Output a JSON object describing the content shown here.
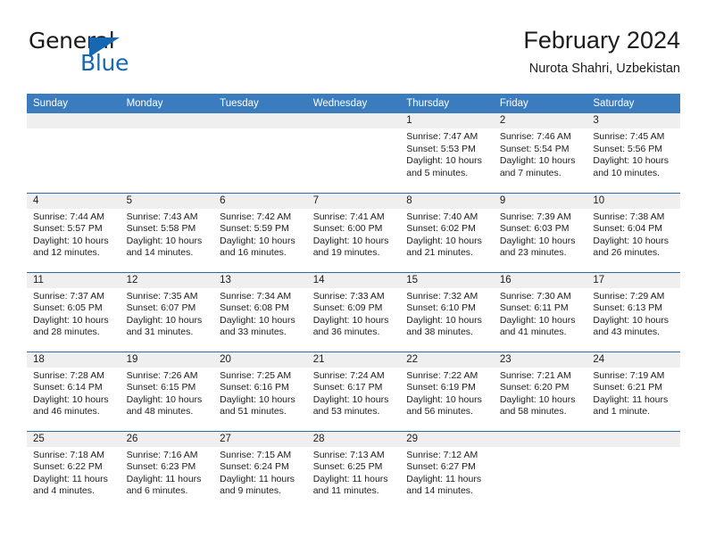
{
  "brand": {
    "name_part1": "General",
    "name_part2": "Blue",
    "triangle_icon": "triangle-icon",
    "accent_color": "#1668b3"
  },
  "header": {
    "title": "February 2024",
    "subtitle": "Nurota Shahri, Uzbekistan"
  },
  "theme": {
    "header_blue": "#3a7cbe",
    "row_rule_blue": "#2b6cad",
    "daynum_band": "#efefef",
    "text": "#1c1c1c"
  },
  "weekdays": [
    "Sunday",
    "Monday",
    "Tuesday",
    "Wednesday",
    "Thursday",
    "Friday",
    "Saturday"
  ],
  "weeks": [
    [
      {
        "day": ""
      },
      {
        "day": ""
      },
      {
        "day": ""
      },
      {
        "day": ""
      },
      {
        "day": "1",
        "sunrise": "Sunrise: 7:47 AM",
        "sunset": "Sunset: 5:53 PM",
        "daylight": "Daylight: 10 hours and 5 minutes."
      },
      {
        "day": "2",
        "sunrise": "Sunrise: 7:46 AM",
        "sunset": "Sunset: 5:54 PM",
        "daylight": "Daylight: 10 hours and 7 minutes."
      },
      {
        "day": "3",
        "sunrise": "Sunrise: 7:45 AM",
        "sunset": "Sunset: 5:56 PM",
        "daylight": "Daylight: 10 hours and 10 minutes."
      }
    ],
    [
      {
        "day": "4",
        "sunrise": "Sunrise: 7:44 AM",
        "sunset": "Sunset: 5:57 PM",
        "daylight": "Daylight: 10 hours and 12 minutes."
      },
      {
        "day": "5",
        "sunrise": "Sunrise: 7:43 AM",
        "sunset": "Sunset: 5:58 PM",
        "daylight": "Daylight: 10 hours and 14 minutes."
      },
      {
        "day": "6",
        "sunrise": "Sunrise: 7:42 AM",
        "sunset": "Sunset: 5:59 PM",
        "daylight": "Daylight: 10 hours and 16 minutes."
      },
      {
        "day": "7",
        "sunrise": "Sunrise: 7:41 AM",
        "sunset": "Sunset: 6:00 PM",
        "daylight": "Daylight: 10 hours and 19 minutes."
      },
      {
        "day": "8",
        "sunrise": "Sunrise: 7:40 AM",
        "sunset": "Sunset: 6:02 PM",
        "daylight": "Daylight: 10 hours and 21 minutes."
      },
      {
        "day": "9",
        "sunrise": "Sunrise: 7:39 AM",
        "sunset": "Sunset: 6:03 PM",
        "daylight": "Daylight: 10 hours and 23 minutes."
      },
      {
        "day": "10",
        "sunrise": "Sunrise: 7:38 AM",
        "sunset": "Sunset: 6:04 PM",
        "daylight": "Daylight: 10 hours and 26 minutes."
      }
    ],
    [
      {
        "day": "11",
        "sunrise": "Sunrise: 7:37 AM",
        "sunset": "Sunset: 6:05 PM",
        "daylight": "Daylight: 10 hours and 28 minutes."
      },
      {
        "day": "12",
        "sunrise": "Sunrise: 7:35 AM",
        "sunset": "Sunset: 6:07 PM",
        "daylight": "Daylight: 10 hours and 31 minutes."
      },
      {
        "day": "13",
        "sunrise": "Sunrise: 7:34 AM",
        "sunset": "Sunset: 6:08 PM",
        "daylight": "Daylight: 10 hours and 33 minutes."
      },
      {
        "day": "14",
        "sunrise": "Sunrise: 7:33 AM",
        "sunset": "Sunset: 6:09 PM",
        "daylight": "Daylight: 10 hours and 36 minutes."
      },
      {
        "day": "15",
        "sunrise": "Sunrise: 7:32 AM",
        "sunset": "Sunset: 6:10 PM",
        "daylight": "Daylight: 10 hours and 38 minutes."
      },
      {
        "day": "16",
        "sunrise": "Sunrise: 7:30 AM",
        "sunset": "Sunset: 6:11 PM",
        "daylight": "Daylight: 10 hours and 41 minutes."
      },
      {
        "day": "17",
        "sunrise": "Sunrise: 7:29 AM",
        "sunset": "Sunset: 6:13 PM",
        "daylight": "Daylight: 10 hours and 43 minutes."
      }
    ],
    [
      {
        "day": "18",
        "sunrise": "Sunrise: 7:28 AM",
        "sunset": "Sunset: 6:14 PM",
        "daylight": "Daylight: 10 hours and 46 minutes."
      },
      {
        "day": "19",
        "sunrise": "Sunrise: 7:26 AM",
        "sunset": "Sunset: 6:15 PM",
        "daylight": "Daylight: 10 hours and 48 minutes."
      },
      {
        "day": "20",
        "sunrise": "Sunrise: 7:25 AM",
        "sunset": "Sunset: 6:16 PM",
        "daylight": "Daylight: 10 hours and 51 minutes."
      },
      {
        "day": "21",
        "sunrise": "Sunrise: 7:24 AM",
        "sunset": "Sunset: 6:17 PM",
        "daylight": "Daylight: 10 hours and 53 minutes."
      },
      {
        "day": "22",
        "sunrise": "Sunrise: 7:22 AM",
        "sunset": "Sunset: 6:19 PM",
        "daylight": "Daylight: 10 hours and 56 minutes."
      },
      {
        "day": "23",
        "sunrise": "Sunrise: 7:21 AM",
        "sunset": "Sunset: 6:20 PM",
        "daylight": "Daylight: 10 hours and 58 minutes."
      },
      {
        "day": "24",
        "sunrise": "Sunrise: 7:19 AM",
        "sunset": "Sunset: 6:21 PM",
        "daylight": "Daylight: 11 hours and 1 minute."
      }
    ],
    [
      {
        "day": "25",
        "sunrise": "Sunrise: 7:18 AM",
        "sunset": "Sunset: 6:22 PM",
        "daylight": "Daylight: 11 hours and 4 minutes."
      },
      {
        "day": "26",
        "sunrise": "Sunrise: 7:16 AM",
        "sunset": "Sunset: 6:23 PM",
        "daylight": "Daylight: 11 hours and 6 minutes."
      },
      {
        "day": "27",
        "sunrise": "Sunrise: 7:15 AM",
        "sunset": "Sunset: 6:24 PM",
        "daylight": "Daylight: 11 hours and 9 minutes."
      },
      {
        "day": "28",
        "sunrise": "Sunrise: 7:13 AM",
        "sunset": "Sunset: 6:25 PM",
        "daylight": "Daylight: 11 hours and 11 minutes."
      },
      {
        "day": "29",
        "sunrise": "Sunrise: 7:12 AM",
        "sunset": "Sunset: 6:27 PM",
        "daylight": "Daylight: 11 hours and 14 minutes."
      },
      {
        "day": ""
      },
      {
        "day": ""
      }
    ]
  ]
}
